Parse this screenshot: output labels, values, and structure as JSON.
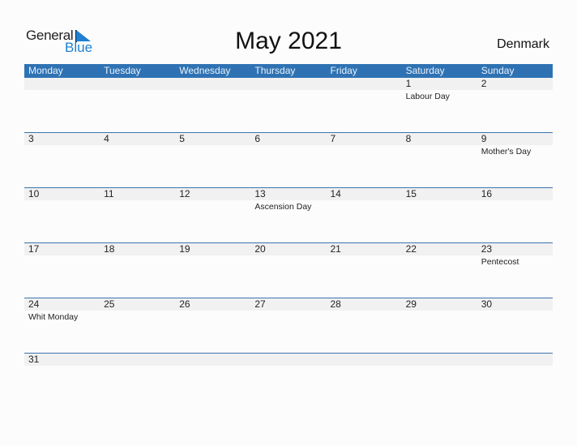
{
  "logo": {
    "general": "General",
    "blue": "Blue"
  },
  "title": "May 2021",
  "country": "Denmark",
  "weekdays": [
    "Monday",
    "Tuesday",
    "Wednesday",
    "Thursday",
    "Friday",
    "Saturday",
    "Sunday"
  ],
  "weeks": [
    [
      {
        "day": "",
        "holiday": ""
      },
      {
        "day": "",
        "holiday": ""
      },
      {
        "day": "",
        "holiday": ""
      },
      {
        "day": "",
        "holiday": ""
      },
      {
        "day": "",
        "holiday": ""
      },
      {
        "day": "1",
        "holiday": "Labour Day"
      },
      {
        "day": "2",
        "holiday": ""
      }
    ],
    [
      {
        "day": "3",
        "holiday": ""
      },
      {
        "day": "4",
        "holiday": ""
      },
      {
        "day": "5",
        "holiday": ""
      },
      {
        "day": "6",
        "holiday": ""
      },
      {
        "day": "7",
        "holiday": ""
      },
      {
        "day": "8",
        "holiday": ""
      },
      {
        "day": "9",
        "holiday": "Mother's Day"
      }
    ],
    [
      {
        "day": "10",
        "holiday": ""
      },
      {
        "day": "11",
        "holiday": ""
      },
      {
        "day": "12",
        "holiday": ""
      },
      {
        "day": "13",
        "holiday": "Ascension Day"
      },
      {
        "day": "14",
        "holiday": ""
      },
      {
        "day": "15",
        "holiday": ""
      },
      {
        "day": "16",
        "holiday": ""
      }
    ],
    [
      {
        "day": "17",
        "holiday": ""
      },
      {
        "day": "18",
        "holiday": ""
      },
      {
        "day": "19",
        "holiday": ""
      },
      {
        "day": "20",
        "holiday": ""
      },
      {
        "day": "21",
        "holiday": ""
      },
      {
        "day": "22",
        "holiday": ""
      },
      {
        "day": "23",
        "holiday": "Pentecost"
      }
    ],
    [
      {
        "day": "24",
        "holiday": "Whit Monday"
      },
      {
        "day": "25",
        "holiday": ""
      },
      {
        "day": "26",
        "holiday": ""
      },
      {
        "day": "27",
        "holiday": ""
      },
      {
        "day": "28",
        "holiday": ""
      },
      {
        "day": "29",
        "holiday": ""
      },
      {
        "day": "30",
        "holiday": ""
      }
    ],
    [
      {
        "day": "31",
        "holiday": ""
      },
      {
        "day": "",
        "holiday": ""
      },
      {
        "day": "",
        "holiday": ""
      },
      {
        "day": "",
        "holiday": ""
      },
      {
        "day": "",
        "holiday": ""
      },
      {
        "day": "",
        "holiday": ""
      },
      {
        "day": "",
        "holiday": ""
      }
    ]
  ]
}
